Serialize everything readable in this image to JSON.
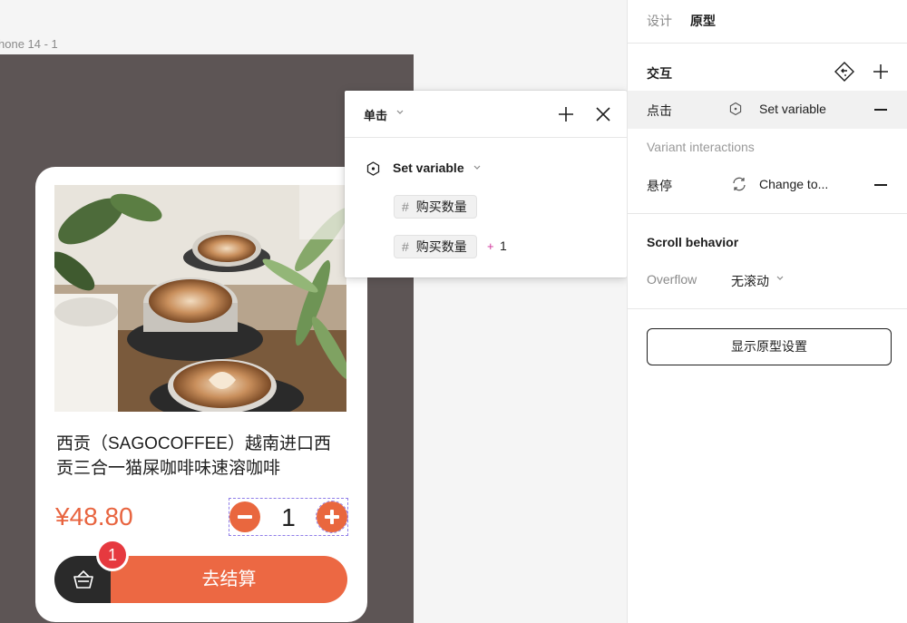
{
  "canvas": {
    "frame_label": "hone 14 - 1",
    "frame_color": "#5d5555"
  },
  "product": {
    "title": "西贡（SAGOCOFFEE）越南进口西贡三合一猫屎咖啡味速溶咖啡",
    "price": "¥48.80",
    "quantity": "1",
    "cart_badge": "1",
    "checkout_label": "去结算",
    "accent_color": "#ec6843",
    "photo": "latte-art-coffee-cups-with-plants"
  },
  "popover": {
    "trigger": "单击",
    "action": "Set variable",
    "target_variable": "购买数量",
    "expression_variable": "购买数量",
    "expression_operator": "+",
    "expression_value": "1"
  },
  "panel": {
    "tabs": [
      "设计",
      "原型"
    ],
    "interactions_title": "交互",
    "interactions": [
      {
        "trigger": "点击",
        "action": "Set variable",
        "icon": "variable-icon"
      },
      {
        "trigger": "悬停",
        "action": "Change to...",
        "icon": "change-to-icon"
      }
    ],
    "variant_label": "Variant interactions",
    "scroll_title": "Scroll behavior",
    "overflow_label": "Overflow",
    "overflow_value": "无滚动",
    "show_settings": "显示原型设置"
  }
}
